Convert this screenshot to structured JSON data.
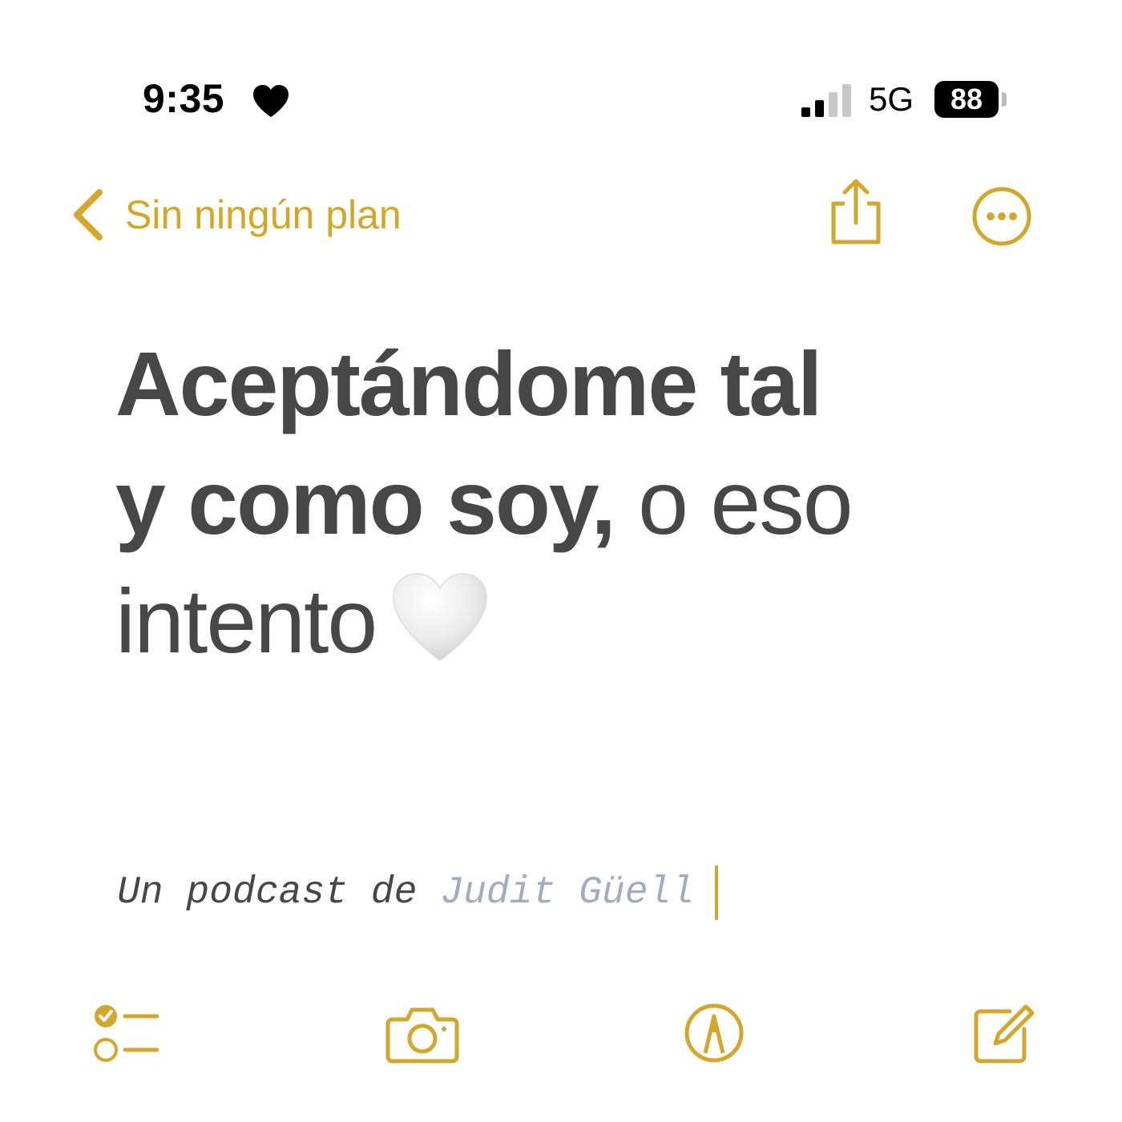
{
  "status_bar": {
    "time": "9:35",
    "network": "5G",
    "battery_percent": "88",
    "signal_bars_active": 2,
    "signal_bars_total": 4
  },
  "nav": {
    "back_label": "Sin ningún plan"
  },
  "note": {
    "title_bold_line1": "Aceptándome tal",
    "title_bold_line2": "y como soy,",
    "title_light_line2": " o eso",
    "title_light_line3": "intento",
    "subtitle_prefix": "Un podcast de ",
    "subtitle_author": "Judit Güell"
  },
  "icons": {
    "status_heart": "heart-icon",
    "title_heart": "white-heart-emoji",
    "toolbar": [
      "checklist-icon",
      "camera-icon",
      "markup-icon",
      "compose-icon"
    ]
  },
  "colors": {
    "accent": "#d4a62a",
    "text": "#474747",
    "author": "#a2abc0",
    "background": "#ffffff"
  }
}
